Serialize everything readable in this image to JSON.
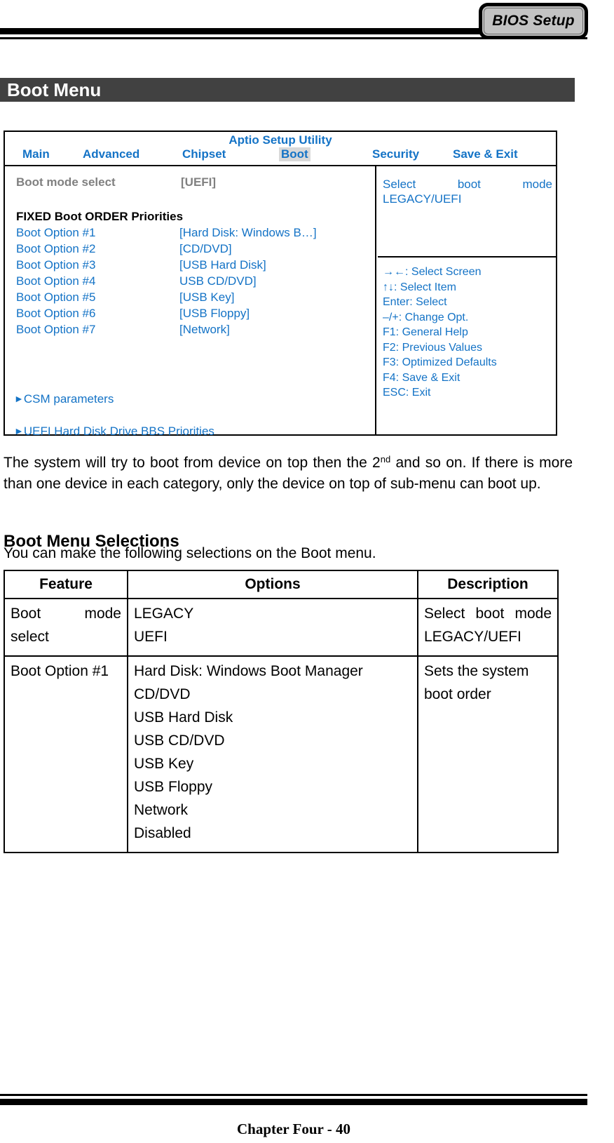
{
  "header": {
    "badge_label": "BIOS Setup"
  },
  "section": {
    "title": "Boot Menu"
  },
  "bios_screen": {
    "utility_title": "Aptio Setup Utility",
    "tabs": [
      {
        "label": "Main",
        "active": false
      },
      {
        "label": "Advanced",
        "active": false
      },
      {
        "label": "Chipset",
        "active": false
      },
      {
        "label": "Boot",
        "active": true
      },
      {
        "label": "Security",
        "active": false
      },
      {
        "label": "Save & Exit",
        "active": false
      }
    ],
    "boot_mode": {
      "label": "Boot mode select",
      "value": "[UEFI]"
    },
    "fixed_boot_heading": "FIXED Boot ORDER Priorities",
    "boot_options": [
      {
        "name": "Boot Option #1",
        "value": "[Hard Disk: Windows B…]"
      },
      {
        "name": "Boot Option #2",
        "value": "[CD/DVD]"
      },
      {
        "name": "Boot Option #3",
        "value": "[USB Hard Disk]"
      },
      {
        "name": "Boot Option #4",
        "value": "USB CD/DVD]"
      },
      {
        "name": "Boot Option #5",
        "value": "[USB Key]"
      },
      {
        "name": "Boot Option #6",
        "value": "[USB Floppy]"
      },
      {
        "name": "Boot Option #7",
        "value": "[Network]"
      }
    ],
    "submenus": [
      {
        "arrow": "►",
        "label": "CSM parameters"
      },
      {
        "arrow": "►",
        "label": "UEFI Hard Disk Drive BBS Priorities"
      }
    ],
    "help_text": "Select boot mode LEGACY/UEFI",
    "key_legend": [
      "→←: Select Screen",
      "↑↓: Select Item",
      "Enter: Select",
      "–/+: Change Opt.",
      "F1: General Help",
      "F2: Previous Values",
      "F3: Optimized Defaults",
      "F4: Save & Exit",
      "ESC: Exit"
    ]
  },
  "paragraph": {
    "part1": "The system will try to boot from device on top then the 2",
    "superscript": "nd",
    "part2": " and so on. If there is more than one device in each category, only the device on top of sub-menu can boot up."
  },
  "selections": {
    "heading": "Boot Menu Selections",
    "intro": "You can make the following selections on the Boot menu.",
    "columns": [
      "Feature",
      "Options",
      "Description"
    ],
    "rows": [
      {
        "feature": "Boot mode select",
        "options": [
          "LEGACY",
          "UEFI"
        ],
        "description": [
          "Select boot mode",
          "LEGACY/UEFI"
        ]
      },
      {
        "feature": "Boot Option #1",
        "options": [
          "Hard Disk: Windows Boot Manager",
          "CD/DVD",
          "USB Hard Disk",
          "USB CD/DVD",
          "USB Key",
          "USB Floppy",
          "Network",
          "Disabled"
        ],
        "description": [
          "Sets the system boot order"
        ]
      }
    ]
  },
  "footer": {
    "text": "Chapter Four - 40"
  },
  "colors": {
    "bios_blue": "#1473c6",
    "bios_gray_text": "#808080",
    "tab_highlight": "#d9d9d9",
    "section_bar": "#414141",
    "badge_fill": "#c3c3c3"
  }
}
